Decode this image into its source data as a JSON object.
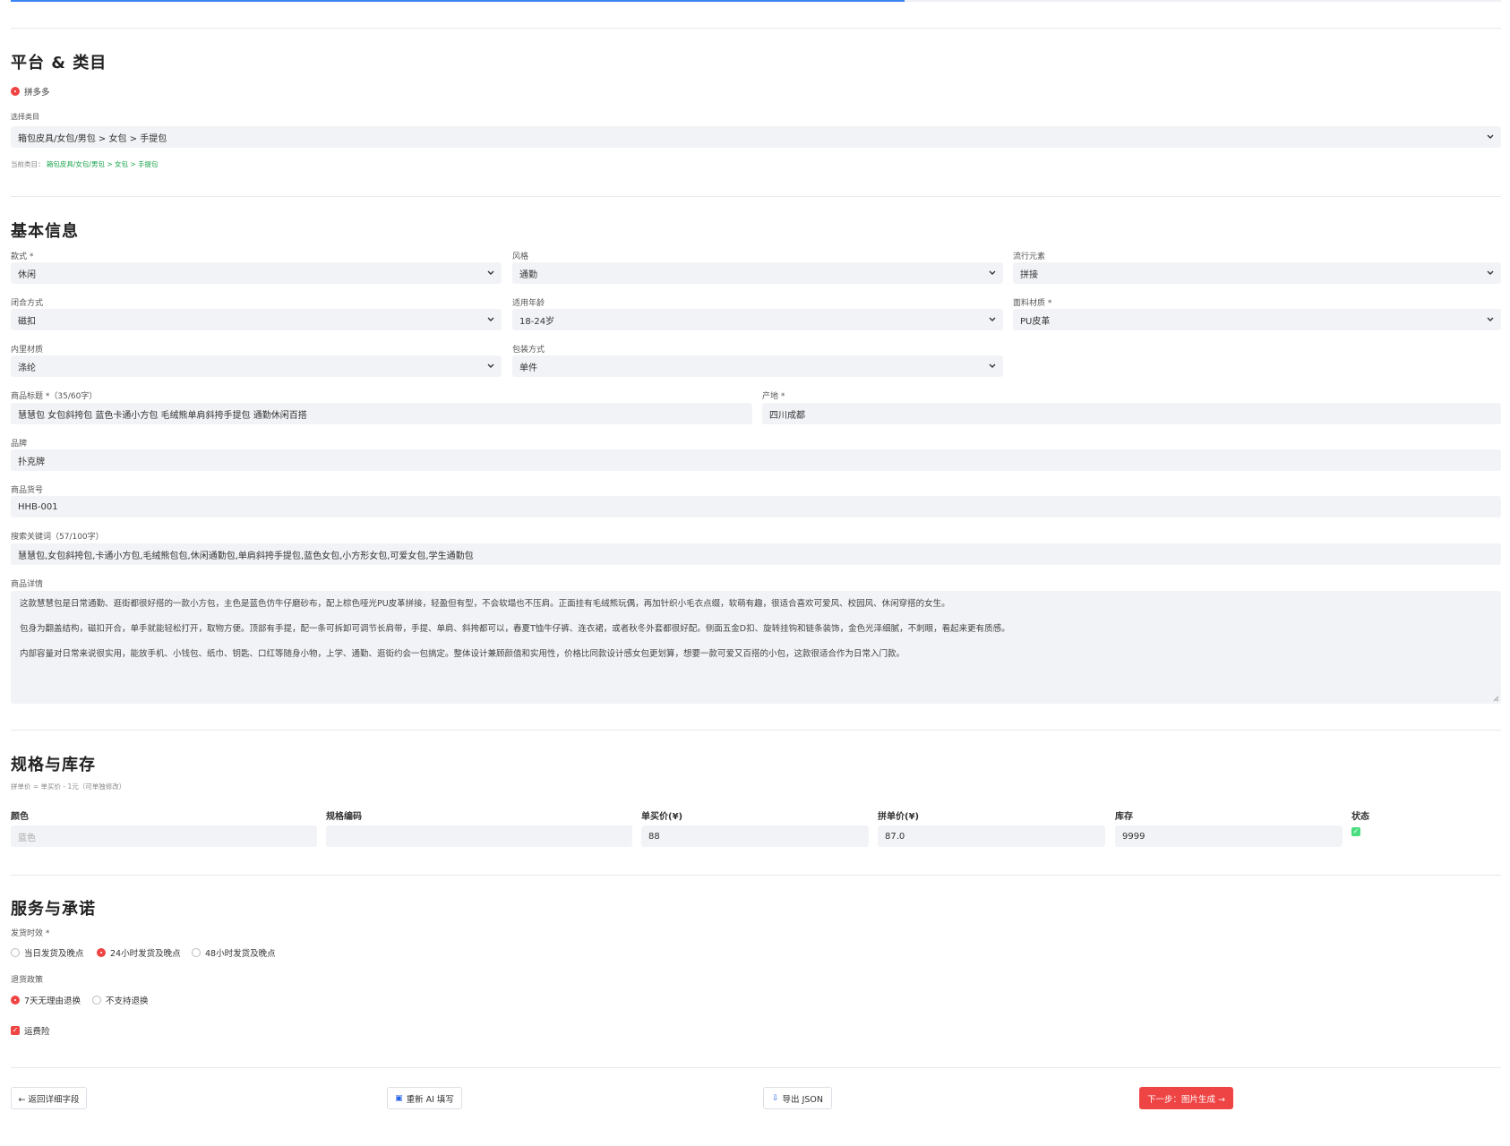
{
  "progress": {
    "fraction": 0.6
  },
  "platform_section": {
    "title": "平台 & 类目",
    "platform_label": "拼多多",
    "category_label": "选择类目",
    "category_value": "箱包皮具/女包/男包 > 女包 > 手提包",
    "current_prefix": "当前类目：",
    "current_value": "箱包皮具/女包/男包 > 女包 > 手提包"
  },
  "basic_section": {
    "title": "基本信息",
    "style_label": "款式 *",
    "style_value": "休闲",
    "fashion_label": "风格",
    "fashion_value": "通勤",
    "trend_label": "流行元素",
    "trend_value": "拼接",
    "closure_label": "闭合方式",
    "closure_value": "磁扣",
    "age_label": "适用年龄",
    "age_value": "18-24岁",
    "fabric_label": "面料材质 *",
    "fabric_value": "PU皮革",
    "lining_label": "内里材质",
    "lining_value": "涤纶",
    "package_label": "包装方式",
    "package_value": "单件",
    "title_label": "商品标题 *（35/60字）",
    "title_value": "慧慧包 女包斜挎包 蓝色卡通小方包 毛绒熊单肩斜挎手提包 通勤休闲百搭",
    "origin_label": "产地 *",
    "origin_value": "四川成都",
    "brand_label": "品牌",
    "brand_value": "扑克牌",
    "sku_label": "商品货号",
    "sku_value": "HHB-001",
    "keywords_label": "搜索关键词（57/100字）",
    "keywords_value": "慧慧包,女包斜挎包,卡通小方包,毛绒熊包包,休闲通勤包,单肩斜挎手提包,蓝色女包,小方形女包,可爱女包,学生通勤包",
    "detail_label": "商品详情",
    "detail_p1": "这款慧慧包是日常通勤、逛街都很好搭的一款小方包，主色是蓝色仿牛仔磨砂布，配上棕色哑光PU皮革拼接，轻盈但有型，不会软塌也不压肩。正面挂有毛绒熊玩偶，再加针织小毛衣点缀，软萌有趣，很适合喜欢可爱风、校园风、休闲穿搭的女生。",
    "detail_p2": "包身为翻盖结构，磁扣开合，单手就能轻松打开，取物方便。顶部有手提，配一条可拆卸可调节长肩带，手提、单肩、斜挎都可以，春夏T恤牛仔裤、连衣裙，或者秋冬外套都很好配。侧面五金D扣、旋转挂钩和链条装饰，金色光泽细腻，不刺眼，看起来更有质感。",
    "detail_p3": "内部容量对日常来说很实用，能放手机、小钱包、纸巾、钥匙、口红等随身小物，上学、通勤、逛街约会一包搞定。整体设计兼顾颜值和实用性，价格比同款设计感女包更划算，想要一款可爱又百搭的小包，这款很适合作为日常入门款。"
  },
  "spec_section": {
    "title": "规格与库存",
    "hint": "拼单价 = 单买价 - 1元（可单独修改）",
    "headers": [
      "颜色",
      "规格编码",
      "单买价(¥)",
      "拼单价(¥)",
      "库存",
      "状态"
    ],
    "row": {
      "color": "蓝色",
      "code": "",
      "single_price": "88",
      "group_price": "87.0",
      "stock": "9999"
    }
  },
  "service_section": {
    "title": "服务与承诺",
    "shipping_label": "发货时效 *",
    "shipping_options": [
      "当日发货及晚点",
      "24小时发货及晚点",
      "48小时发货及晚点"
    ],
    "shipping_selected": 1,
    "return_label": "退货政策",
    "return_options": [
      "7天无理由退换",
      "不支持退换"
    ],
    "return_selected": 0,
    "insurance_label": "运费险"
  },
  "footer": {
    "back_label": "← 返回详细字段",
    "refill_label": "重新 AI 填写",
    "export_label": "导出 JSON",
    "next_label": "下一步：图片生成 →"
  },
  "colors": {
    "accent": "#ef4444",
    "progress": "#3b82f6",
    "field_bg": "#f2f3f6",
    "category_link": "#16a34a",
    "status_ok": "#4ade80"
  },
  "icons": [
    "chevron-down-icon",
    "radio-icon",
    "checkbox-icon",
    "refresh-icon",
    "export-icon",
    "resize-grip-icon"
  ]
}
